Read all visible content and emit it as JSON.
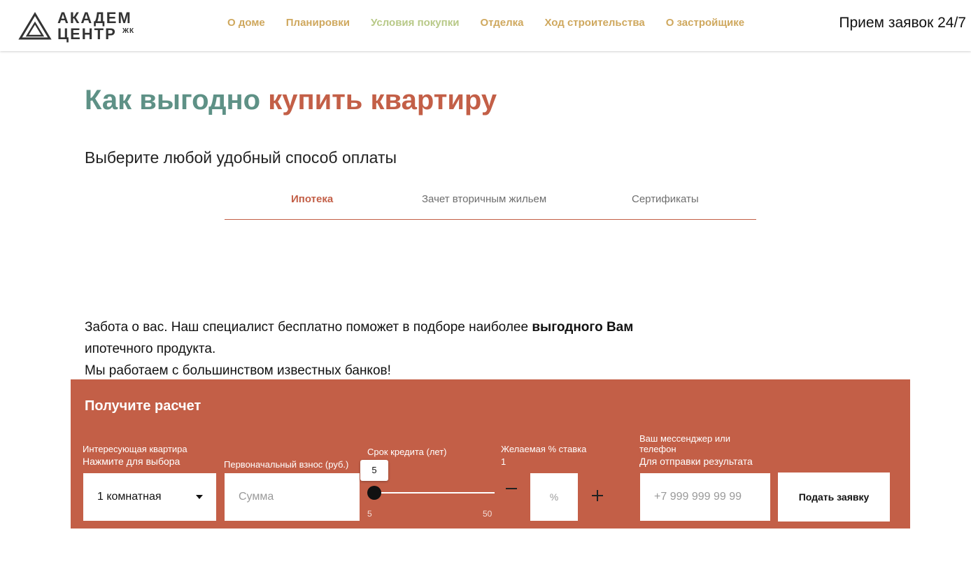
{
  "header": {
    "logo": {
      "line1": "АКАДЕМ",
      "line2": "ЦЕНТР",
      "small": "ЖК"
    },
    "nav": [
      {
        "label": "О доме"
      },
      {
        "label": "Планировки"
      },
      {
        "label": "Условия покупки"
      },
      {
        "label": "Отделка"
      },
      {
        "label": "Ход строительства"
      },
      {
        "label": "О застройщике"
      }
    ],
    "hotline": "Прием заявок 24/7"
  },
  "hero": {
    "title_part1": "Как выгодно",
    "title_part2": "купить квартиру",
    "subtitle": "Выберите любой удобный способ оплаты"
  },
  "tabs": [
    {
      "label": "Ипотека",
      "active": true
    },
    {
      "label": "Зачет вторичным жильем",
      "active": false
    },
    {
      "label": "Сертификаты",
      "active": false
    }
  ],
  "info": {
    "line1_start": "Забота о вас. Наш специалист бесплатно поможет в подборе наиболее ",
    "line1_bold": "выгодного Вам",
    "line2": "ипотечного продукта.",
    "line3": "Мы работаем с большинством известных банков!"
  },
  "calc": {
    "title": "Получите расчет",
    "apartment": {
      "label": "Интересующая квартира",
      "hint": "Нажмите для выбора",
      "value": "1 комнатная"
    },
    "down_payment": {
      "label": "Первоначальный взнос (руб.)",
      "placeholder": "Сумма"
    },
    "term": {
      "label": "Срок кредита (лет)",
      "value": "5",
      "min": "5",
      "max": "50"
    },
    "rate": {
      "label": "Желаемая % ставка",
      "value": "1",
      "placeholder": "%"
    },
    "contact": {
      "label": "Ваш мессенджер или телефон",
      "hint": "Для отправки результата",
      "placeholder": "+7 999 999 99 99"
    },
    "submit_label": "Подать заявку"
  },
  "colors": {
    "accent_green": "#5e9186",
    "accent_terracotta": "#c35f47",
    "nav_gold": "#cfa85e",
    "nav_active": "#b8c988"
  }
}
